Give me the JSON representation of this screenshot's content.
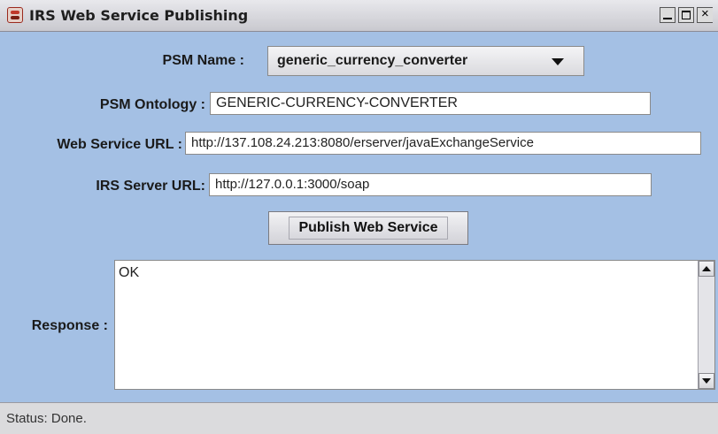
{
  "window": {
    "title": "IRS Web Service Publishing",
    "controls": {
      "minimize": "minimize",
      "maximize": "maximize",
      "close": "×"
    }
  },
  "form": {
    "psm_name": {
      "label": "PSM Name :",
      "value": "generic_currency_converter"
    },
    "psm_ontology": {
      "label": "PSM Ontology :",
      "value": "GENERIC-CURRENCY-CONVERTER"
    },
    "web_service_url": {
      "label": "Web Service URL :",
      "value": "http://137.108.24.213:8080/erserver/javaExchangeService"
    },
    "irs_server_url": {
      "label": "IRS Server URL:",
      "value": "http://127.0.0.1:3000/soap"
    },
    "publish_button": {
      "label": "Publish Web Service"
    },
    "response": {
      "label": "Response :",
      "value": "OK"
    }
  },
  "status": {
    "text": "Status: Done."
  },
  "colors": {
    "background": "#a4c0e4",
    "titlebar": "#d8d8de",
    "statusbar": "#dbdbdd"
  }
}
